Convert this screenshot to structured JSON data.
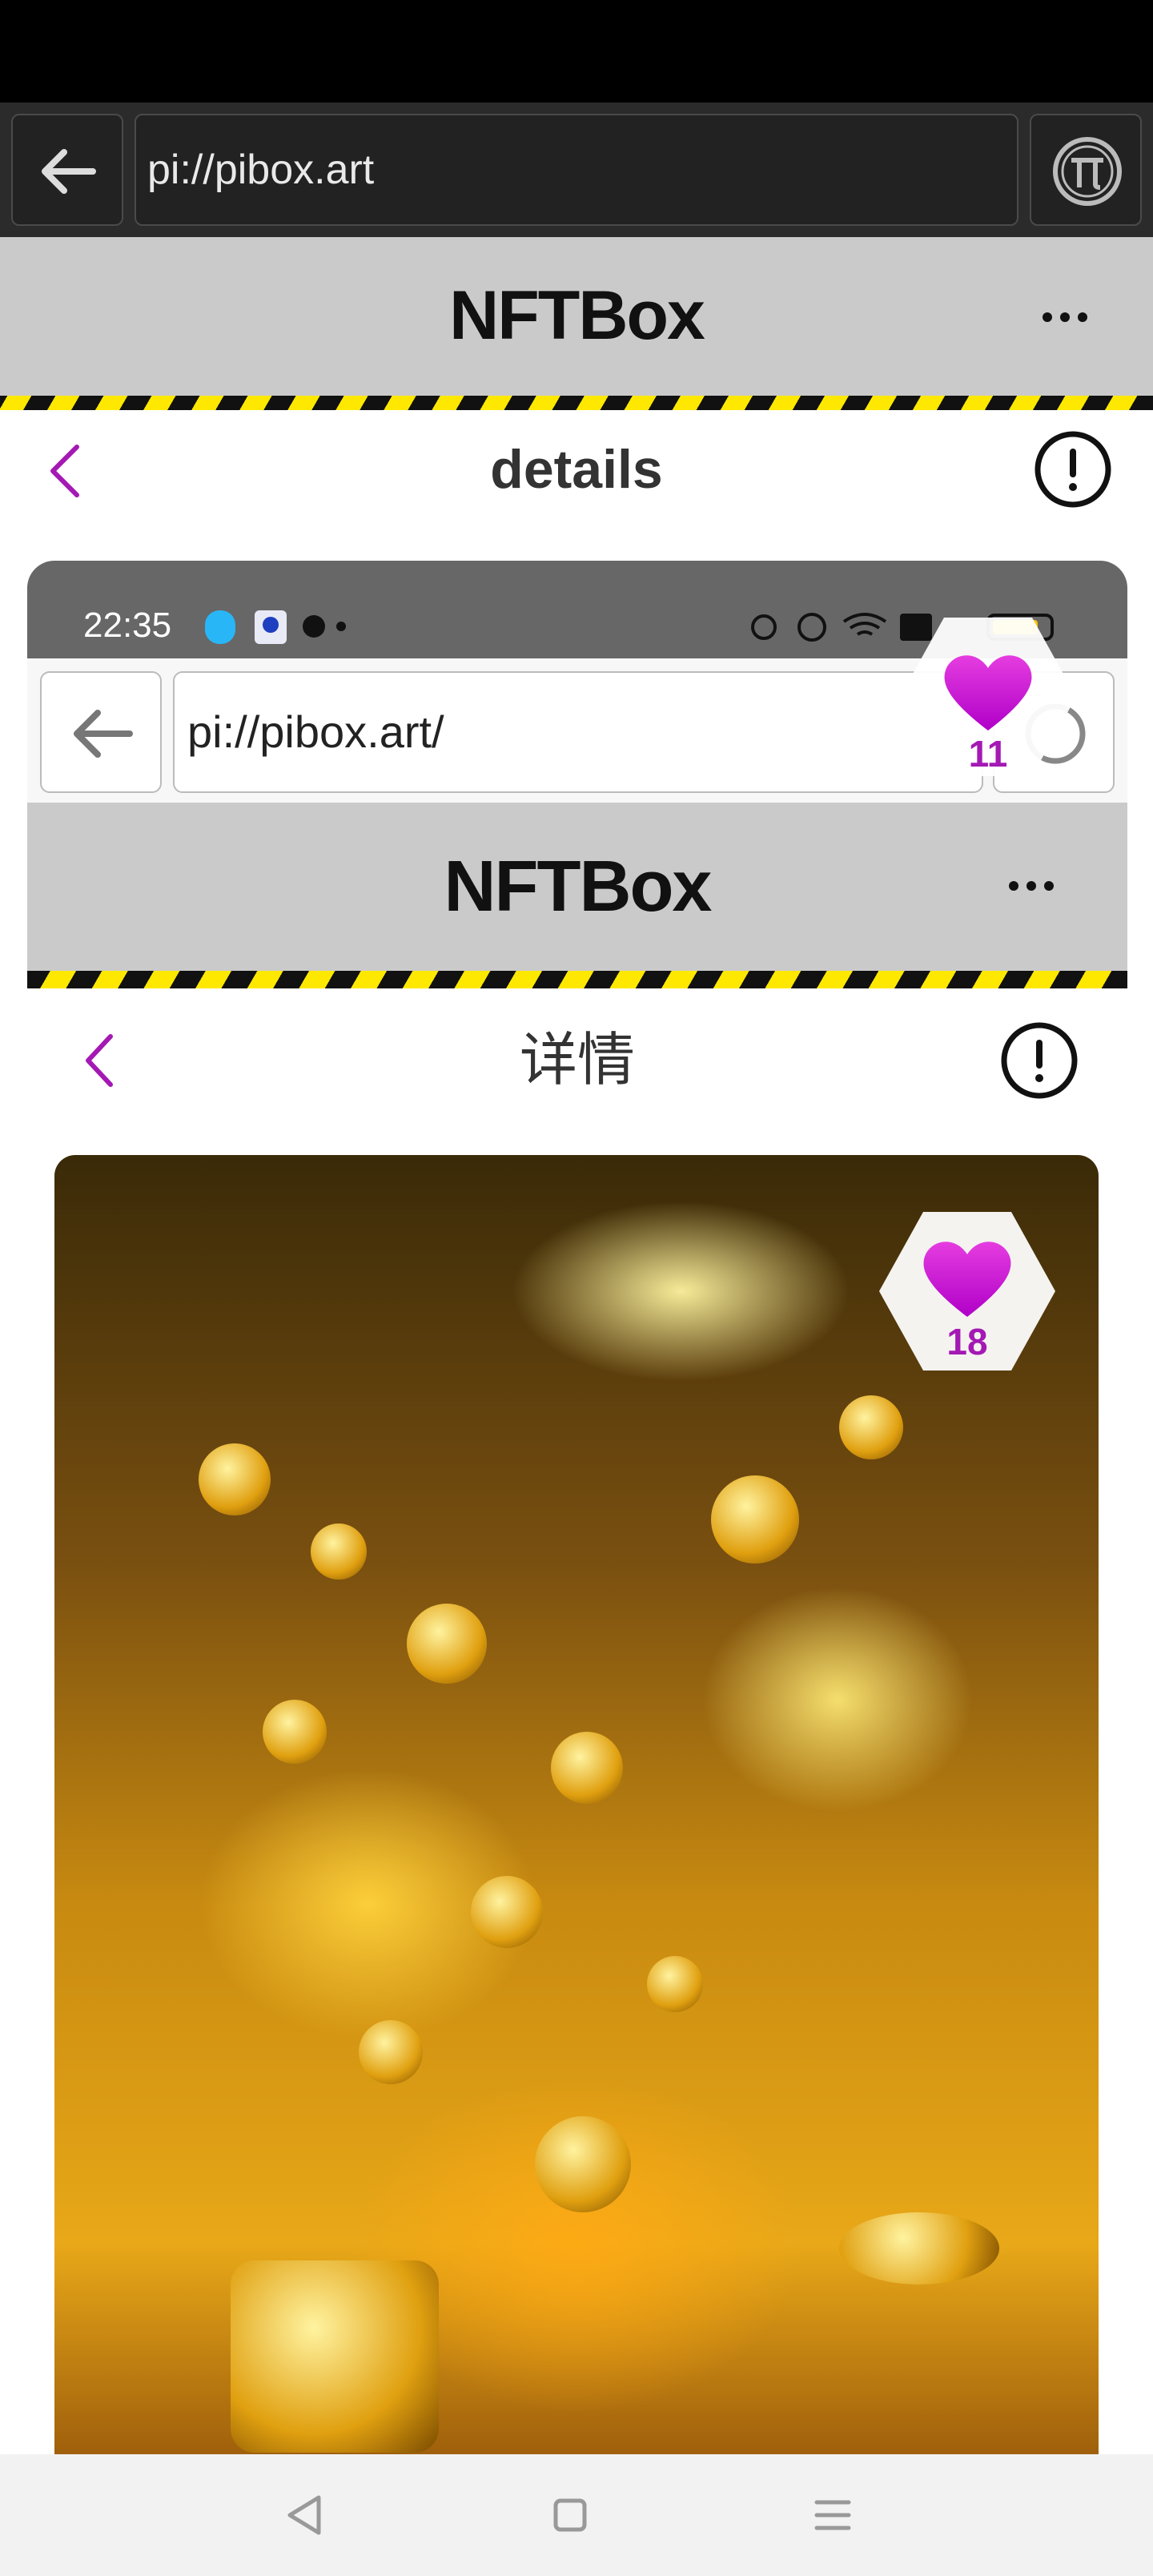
{
  "browser": {
    "url": "pi://pibox.art",
    "icons": {
      "back": "arrow-left-icon",
      "pi": "pi-network-icon"
    }
  },
  "site": {
    "title": "NFTBox",
    "more_icon": "more-dots-icon"
  },
  "detail": {
    "title": "details",
    "back_icon": "chevron-left-icon",
    "report_icon": "exclamation-circle-icon"
  },
  "like_badge": {
    "icon": "heart-icon",
    "count": "11"
  },
  "embedded_screenshot": {
    "status_time": "22:35",
    "url": "pi://pibox.art/",
    "site_title": "NFTBox",
    "detail_title": "详情",
    "like_count": "18"
  },
  "colors": {
    "accent": "#a419b4",
    "heart": "#d81fe0",
    "hazard_yellow": "#ffe800",
    "header_bg": "#cacaca"
  },
  "nav": {
    "back_icon": "triangle-back-icon",
    "home_icon": "square-home-icon",
    "menu_icon": "menu-lines-icon"
  }
}
